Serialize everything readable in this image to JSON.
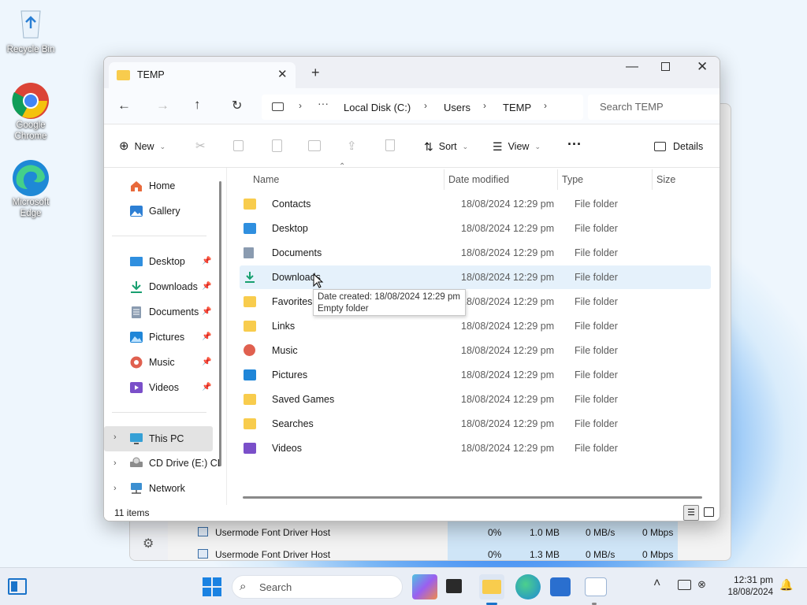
{
  "desktop": {
    "icons": [
      {
        "label": "Recycle Bin"
      },
      {
        "label": "Google Chrome"
      },
      {
        "label": "Microsoft Edge"
      }
    ]
  },
  "explorer": {
    "tab_title": "TEMP",
    "search_placeholder": "Search TEMP",
    "breadcrumb": [
      "Local Disk (C:)",
      "Users",
      "TEMP"
    ],
    "commands": {
      "new": "New",
      "sort": "Sort",
      "view": "View",
      "details": "Details"
    },
    "sidebar": {
      "top": [
        {
          "label": "Home"
        },
        {
          "label": "Gallery"
        }
      ],
      "quick": [
        {
          "label": "Desktop"
        },
        {
          "label": "Downloads"
        },
        {
          "label": "Documents"
        },
        {
          "label": "Pictures"
        },
        {
          "label": "Music"
        },
        {
          "label": "Videos"
        }
      ],
      "drives": [
        {
          "label": "This PC"
        },
        {
          "label": "CD Drive (E:) CD"
        },
        {
          "label": "Network"
        }
      ]
    },
    "columns": {
      "name": "Name",
      "date": "Date modified",
      "type": "Type",
      "size": "Size"
    },
    "files": [
      {
        "name": "Contacts",
        "date": "18/08/2024 12:29 pm",
        "type": "File folder"
      },
      {
        "name": "Desktop",
        "date": "18/08/2024 12:29 pm",
        "type": "File folder"
      },
      {
        "name": "Documents",
        "date": "18/08/2024 12:29 pm",
        "type": "File folder"
      },
      {
        "name": "Downloads",
        "date": "18/08/2024 12:29 pm",
        "type": "File folder"
      },
      {
        "name": "Favorites",
        "date": "18/08/2024 12:29 pm",
        "type": "File folder"
      },
      {
        "name": "Links",
        "date": "18/08/2024 12:29 pm",
        "type": "File folder"
      },
      {
        "name": "Music",
        "date": "18/08/2024 12:29 pm",
        "type": "File folder"
      },
      {
        "name": "Pictures",
        "date": "18/08/2024 12:29 pm",
        "type": "File folder"
      },
      {
        "name": "Saved Games",
        "date": "18/08/2024 12:29 pm",
        "type": "File folder"
      },
      {
        "name": "Searches",
        "date": "18/08/2024 12:29 pm",
        "type": "File folder"
      },
      {
        "name": "Videos",
        "date": "18/08/2024 12:29 pm",
        "type": "File folder"
      }
    ],
    "tooltip": {
      "line1": "Date created: 18/08/2024 12:29 pm",
      "line2": "Empty folder"
    },
    "status": "11 items"
  },
  "background_window": {
    "rows": [
      {
        "name": "Usermode Font Driver Host",
        "cpu": "0%",
        "mem": "1.0 MB",
        "disk": "0 MB/s",
        "net": "0 Mbps"
      },
      {
        "name": "Usermode Font Driver Host",
        "cpu": "0%",
        "mem": "1.3 MB",
        "disk": "0 MB/s",
        "net": "0 Mbps"
      }
    ]
  },
  "taskbar": {
    "search": "Search",
    "time": "12:31 pm",
    "date": "18/08/2024"
  }
}
